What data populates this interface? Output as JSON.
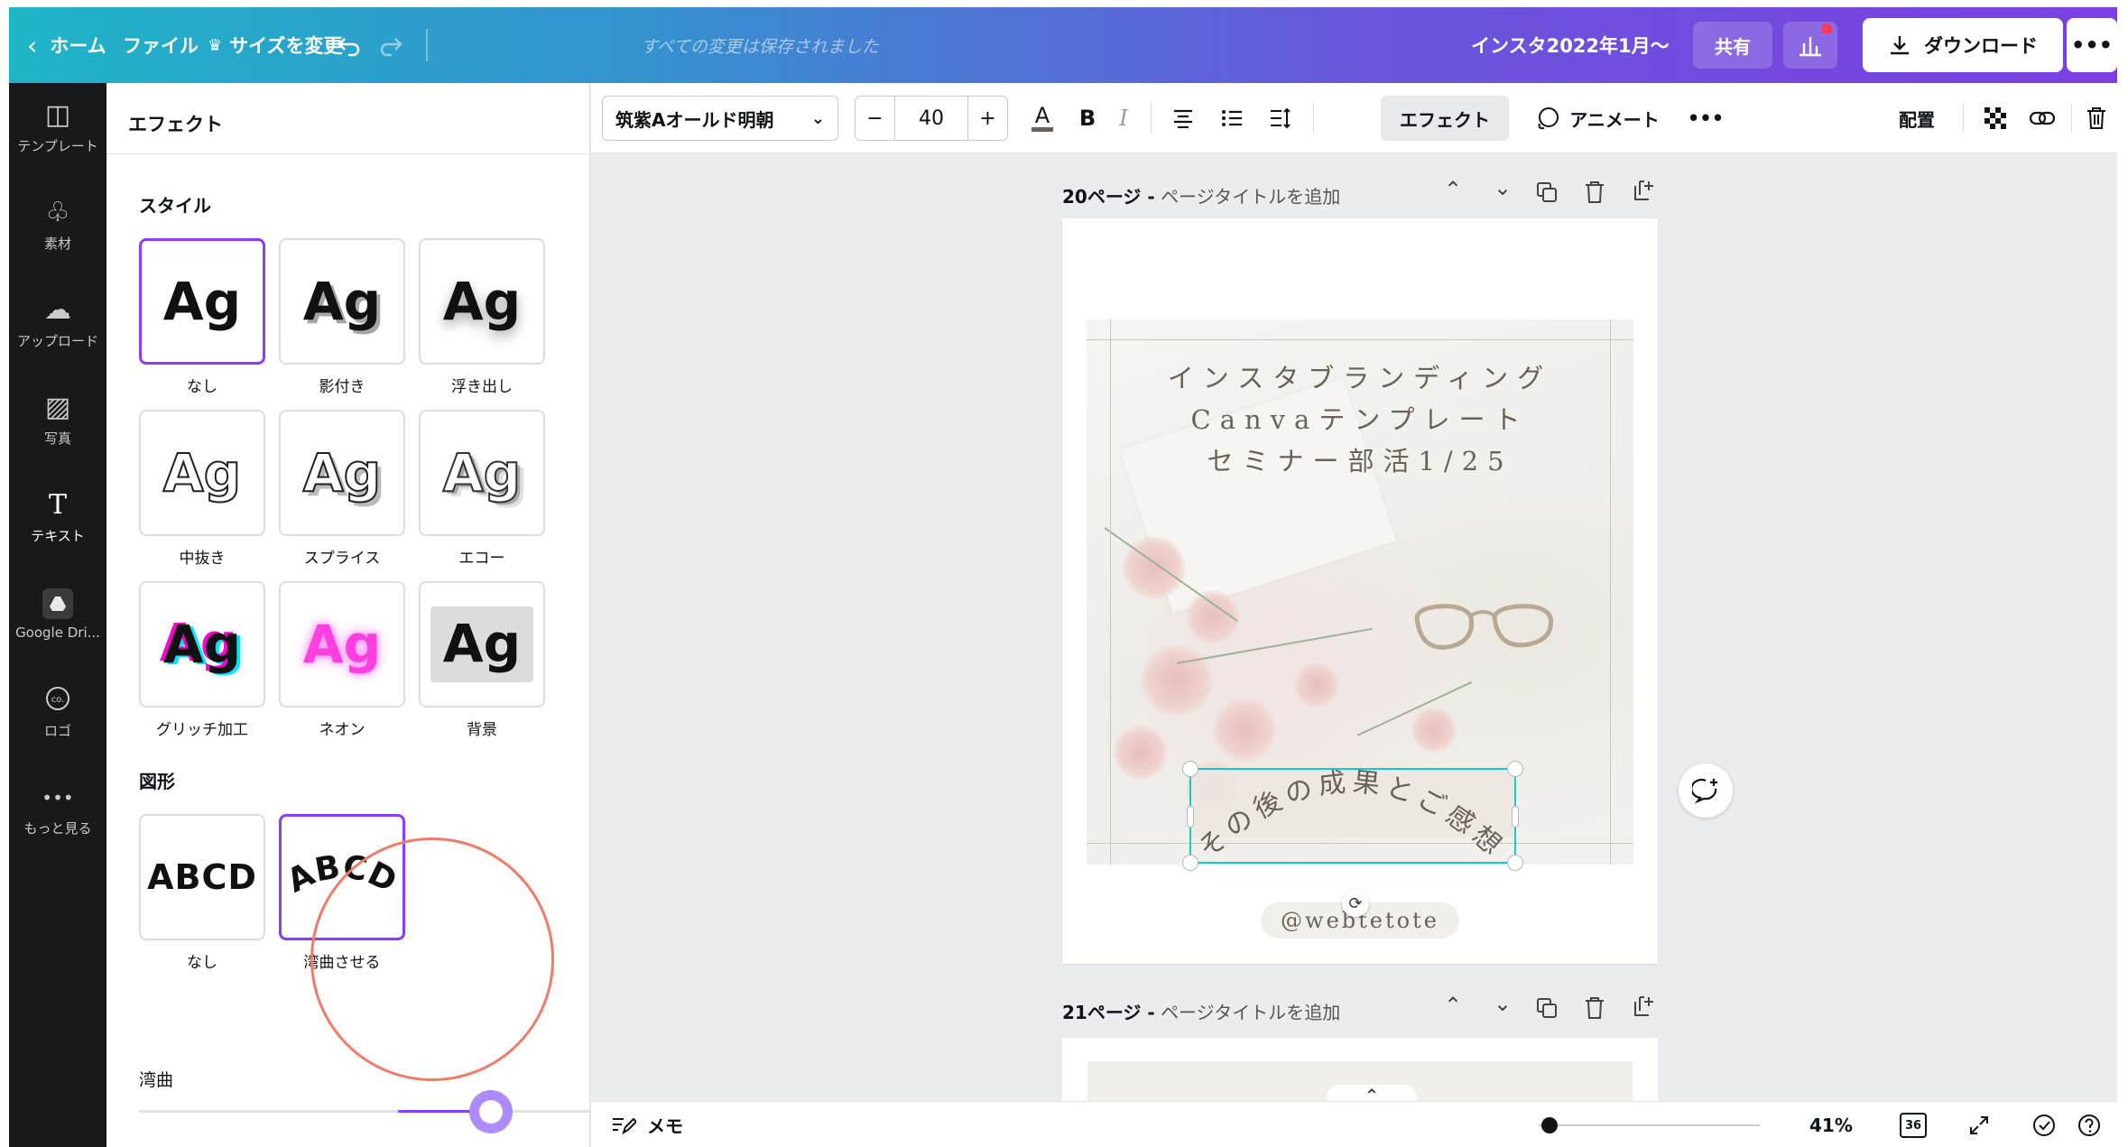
{
  "topbar": {
    "home": "ホーム",
    "file": "ファイル",
    "resize": "サイズを変更",
    "saved_status": "すべての変更は保存されました",
    "doc_title": "インスタ2022年1月〜",
    "share": "共有",
    "download": "ダウンロード",
    "more": "•••"
  },
  "rail": {
    "items": [
      {
        "label": "テンプレート",
        "icon": "layout-icon"
      },
      {
        "label": "素材",
        "icon": "shapes-icon"
      },
      {
        "label": "アップロード",
        "icon": "cloud-upload-icon"
      },
      {
        "label": "写真",
        "icon": "image-icon"
      },
      {
        "label": "テキスト",
        "icon": "text-icon"
      },
      {
        "label": "Google Dri...",
        "icon": "google-drive-icon"
      },
      {
        "label": "ロゴ",
        "icon": "logo-icon"
      },
      {
        "label": "もっと見る",
        "icon": "more-icon"
      }
    ]
  },
  "panel": {
    "title": "エフェクト",
    "style_heading": "スタイル",
    "sample": "Ag",
    "styles": [
      {
        "label": "なし",
        "selected": true
      },
      {
        "label": "影付き"
      },
      {
        "label": "浮き出し"
      },
      {
        "label": "中抜き"
      },
      {
        "label": "スプライス"
      },
      {
        "label": "エコー"
      },
      {
        "label": "グリッチ加工"
      },
      {
        "label": "ネオン"
      },
      {
        "label": "背景"
      }
    ],
    "shape_heading": "図形",
    "shape_sample": "ABCD",
    "shapes": [
      {
        "label": "なし"
      },
      {
        "label": "湾曲させる",
        "selected": true
      }
    ],
    "curve_label": "湾曲",
    "curve_value": "37",
    "curve_fraction": 0.68
  },
  "toolbar": {
    "font": "筑紫Aオールド明朝",
    "minus": "−",
    "size": "40",
    "plus": "+",
    "color_letter": "A",
    "bold": "B",
    "italic": "I",
    "effects": "エフェクト",
    "animate": "アニメート",
    "more": "•••",
    "position": "配置"
  },
  "pages": {
    "page20_num": "20ページ -",
    "page20_sub": "ページタイトルを追加",
    "page21_num": "21ページ -",
    "page21_sub": "ページタイトルを追加"
  },
  "design": {
    "title_line1": "インスタブランディング",
    "title_line2": "Canvaテンプレート",
    "title_line3": "セミナー部活1/25",
    "curved_text": "その後の成果とご感想",
    "handle": "@webtetote",
    "text_color": "#6a6258"
  },
  "bottombar": {
    "notes": "メモ",
    "zoom": "41%",
    "zoom_fraction": 0.05,
    "page_count": "36"
  },
  "colors": {
    "accent": "#8b3dff",
    "selection": "#16c7d4",
    "highlight_circle": "#ef7c6a"
  }
}
